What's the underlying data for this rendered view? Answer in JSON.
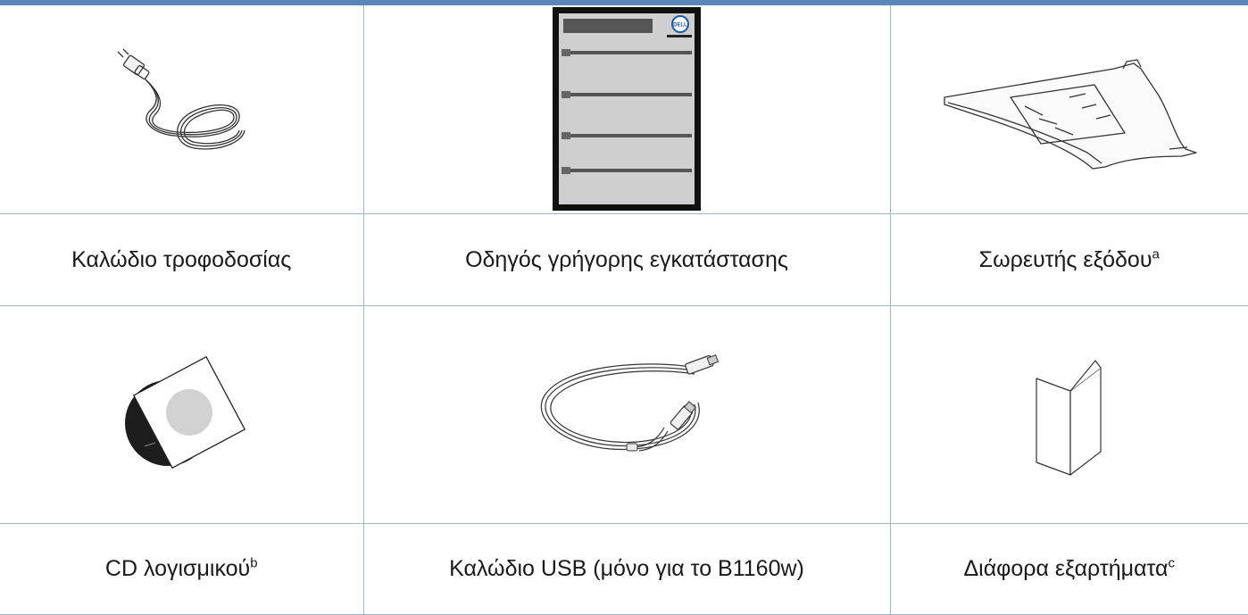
{
  "items": [
    {
      "label": "Καλώδιο τροφοδοσίας",
      "note": "",
      "icon": "power-cable-icon"
    },
    {
      "label": "Οδηγός γρήγορης εγκατάστασης",
      "note": "",
      "icon": "quick-install-guide-icon",
      "logo_text": "DELL"
    },
    {
      "label": "Σωρευτής εξόδου",
      "note": "a",
      "icon": "output-stacker-icon"
    },
    {
      "label": "CD λογισμικού",
      "note": "b",
      "icon": "software-cd-icon"
    },
    {
      "label": "Καλώδιο USB (μόνο για το B1160w)",
      "note": "",
      "icon": "usb-cable-icon"
    },
    {
      "label": "Διάφορα εξαρτήματα",
      "note": "c",
      "icon": "misc-parts-booklet-icon"
    }
  ],
  "colors": {
    "accent_bar": "#5b86b8",
    "grid_lines": "#9fb4cc"
  }
}
